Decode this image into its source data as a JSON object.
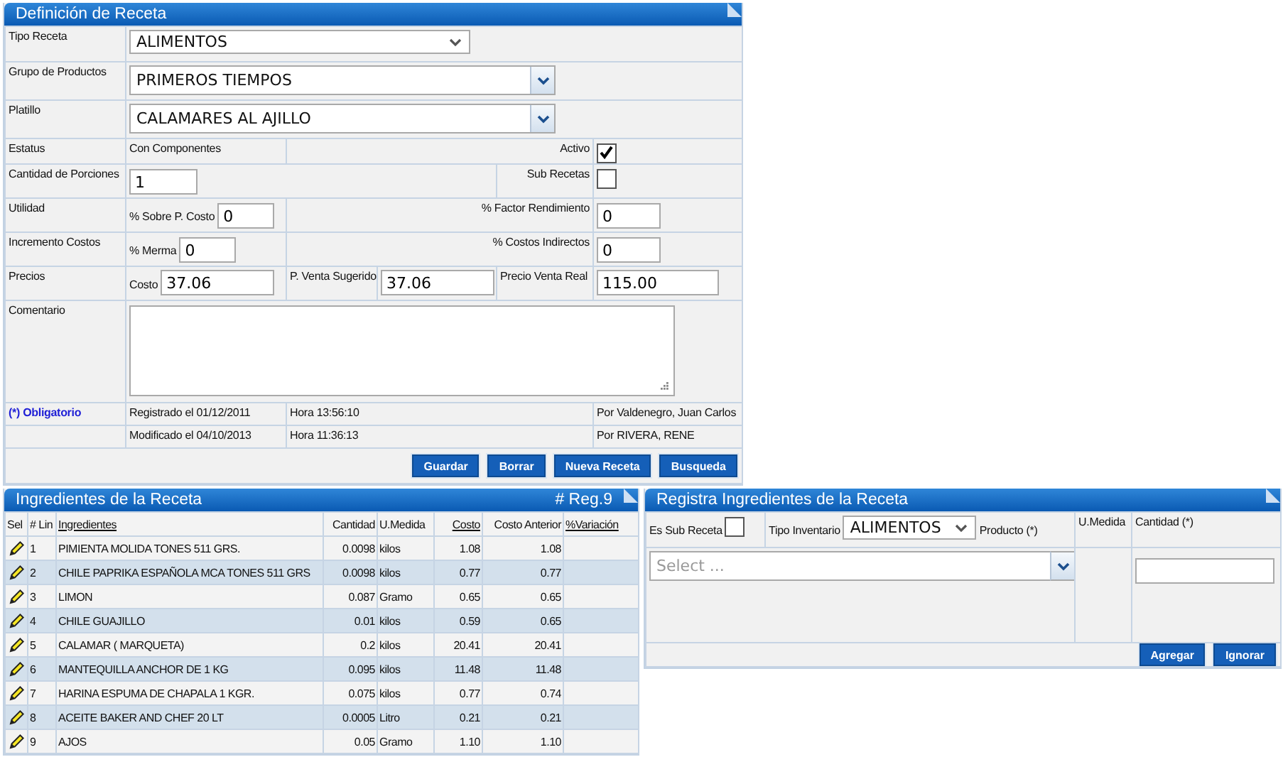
{
  "recipe": {
    "title": "Definición de Receta",
    "tipo_receta": {
      "label": "Tipo Receta",
      "value": "ALIMENTOS"
    },
    "grupo_productos": {
      "label": "Grupo de Productos",
      "value": "PRIMEROS TIEMPOS"
    },
    "platillo": {
      "label": "Platillo",
      "value": "CALAMARES AL AJILLO"
    },
    "estatus": {
      "label": "Estatus",
      "value": "Con Componentes"
    },
    "activo": {
      "label": "Activo",
      "checked": true
    },
    "porciones": {
      "label": "Cantidad de Porciones",
      "value": "1"
    },
    "sub_recetas": {
      "label": "Sub Recetas",
      "checked": false
    },
    "utilidad": {
      "label": "Utilidad",
      "field_label": "% Sobre P. Costo",
      "value": "0"
    },
    "factor_rendimiento": {
      "label": "% Factor Rendimiento",
      "value": "0"
    },
    "incremento_costos": {
      "label": "Incremento Costos",
      "field_label": "% Merma",
      "value": "0"
    },
    "costos_indirectos": {
      "label": "% Costos Indirectos",
      "value": "0"
    },
    "precios": {
      "label": "Precios",
      "costo_label": "Costo",
      "costo": "37.06",
      "sugerido_label": "P. Venta Sugerido",
      "sugerido": "37.06",
      "real_label": "Precio Venta Real",
      "real": "115.00"
    },
    "comentario": {
      "label": "Comentario"
    },
    "obligatorio": "(*) Obligatorio",
    "registrado": {
      "fecha": "Registrado el 01/12/2011",
      "hora": "Hora 13:56:10",
      "por": "Por Valdenegro, Juan Carlos"
    },
    "modificado": {
      "fecha": "Modificado el 04/10/2013",
      "hora": "Hora 11:36:13",
      "por": "Por RIVERA, RENE"
    },
    "buttons": [
      "Guardar",
      "Borrar",
      "Nueva Receta",
      "Busqueda"
    ]
  },
  "ingredients": {
    "title": "Ingredientes de la Receta",
    "count": "# Reg.9",
    "columns": [
      {
        "label": "Sel",
        "sortable": false
      },
      {
        "label": "# Lin",
        "sortable": false
      },
      {
        "label": "Ingredientes",
        "sortable": true
      },
      {
        "label": "Cantidad",
        "sortable": false
      },
      {
        "label": "U.Medida",
        "sortable": false
      },
      {
        "label": "Costo",
        "sortable": true
      },
      {
        "label": "Costo Anterior",
        "sortable": false
      },
      {
        "label": "%Variación",
        "sortable": true
      }
    ],
    "rows": [
      {
        "lin": "1",
        "name": "PIMIENTA MOLIDA TONES 511 GRS.",
        "cantidad": "0.0098",
        "unidad": "kilos",
        "costo": "1.08",
        "costo_anterior": "1.08"
      },
      {
        "lin": "2",
        "name": "CHILE PAPRIKA ESPAÑOLA MCA TONES 511 GRS",
        "cantidad": "0.0098",
        "unidad": "kilos",
        "costo": "0.77",
        "costo_anterior": "0.77"
      },
      {
        "lin": "3",
        "name": "LIMON",
        "cantidad": "0.087",
        "unidad": "Gramo",
        "costo": "0.65",
        "costo_anterior": "0.65"
      },
      {
        "lin": "4",
        "name": "CHILE GUAJILLO",
        "cantidad": "0.01",
        "unidad": "kilos",
        "costo": "0.59",
        "costo_anterior": "0.65"
      },
      {
        "lin": "5",
        "name": "CALAMAR ( MARQUETA)",
        "cantidad": "0.2",
        "unidad": "kilos",
        "costo": "20.41",
        "costo_anterior": "20.41"
      },
      {
        "lin": "6",
        "name": "MANTEQUILLA ANCHOR DE 1 KG",
        "cantidad": "0.095",
        "unidad": "kilos",
        "costo": "11.48",
        "costo_anterior": "11.48"
      },
      {
        "lin": "7",
        "name": "HARINA ESPUMA DE CHAPALA 1 KGR.",
        "cantidad": "0.075",
        "unidad": "kilos",
        "costo": "0.77",
        "costo_anterior": "0.74"
      },
      {
        "lin": "8",
        "name": "ACEITE BAKER AND CHEF 20 LT",
        "cantidad": "0.0005",
        "unidad": "Litro",
        "costo": "0.21",
        "costo_anterior": "0.21"
      },
      {
        "lin": "9",
        "name": "AJOS",
        "cantidad": "0.05",
        "unidad": "Gramo",
        "costo": "1.10",
        "costo_anterior": "1.10"
      }
    ]
  },
  "register": {
    "title": "Registra Ingredientes de la Receta",
    "sub_receta": {
      "label": "Es Sub Receta",
      "checked": false
    },
    "tipo_inventario": {
      "label": "Tipo Inventario",
      "value": "ALIMENTOS"
    },
    "producto": {
      "label": "Producto (*)",
      "placeholder": "Select ..."
    },
    "unidad_label": "U.Medida",
    "cantidad_label": "Cantidad (*)",
    "buttons": [
      "Agregar",
      "Ignorar"
    ]
  }
}
